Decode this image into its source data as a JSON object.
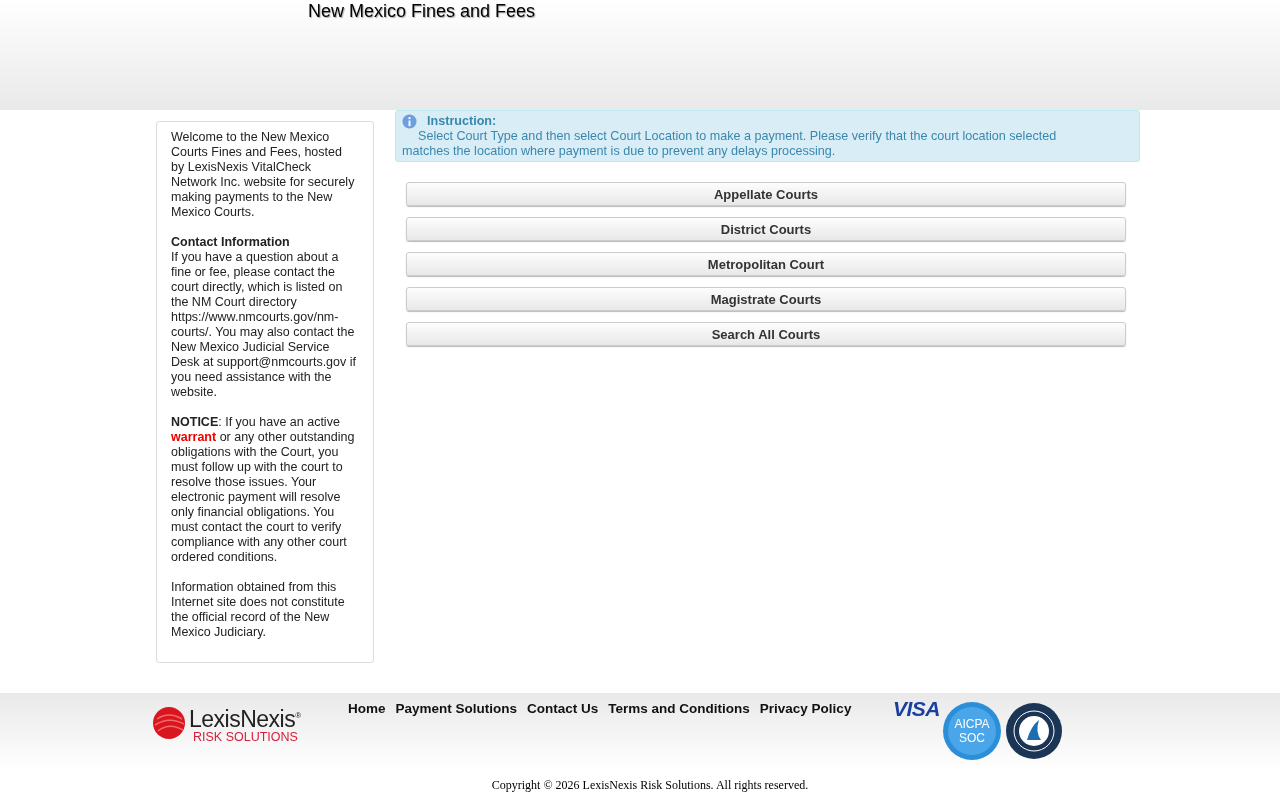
{
  "header": {
    "title": "New Mexico Fines and Fees"
  },
  "sidebar": {
    "intro": "Welcome to the New Mexico Courts Fines and Fees, hosted by LexisNexis VitalCheck Network Inc. website for securely making payments to the New Mexico Courts.",
    "contact_heading": "Contact Information",
    "contact_text": "If you have a question about a fine or fee, please contact the court directly, which is listed on the NM Court directory https://www.nmcourts.gov/nm-courts/. You may also contact the New Mexico Judicial Service Desk at support@nmcourts.gov if you need assistance with the website.",
    "notice_parts": [
      {
        "kind": "bold",
        "text": "NOTICE"
      },
      {
        "kind": "plain",
        "text": ": If you have an active "
      },
      {
        "kind": "alert",
        "text": "warrant"
      },
      {
        "kind": "plain",
        "text": " or any other outstanding obligations with the Court, you must follow up with the court to resolve those issues. Your electronic payment will resolve only financial obligations. You must contact the court to verify compliance with any other court ordered conditions."
      }
    ],
    "disclaimer": "Information obtained from this Internet site does not constitute the official record of the New Mexico Judiciary."
  },
  "instruction": {
    "heading": "Instruction:",
    "text": "Select Court Type and then select Court Location to make a payment. Please verify that the court location selected matches the location where payment is due to prevent any delays processing."
  },
  "court_buttons": [
    "Appellate Courts",
    "District Courts",
    "Metropolitan Court",
    "Magistrate Courts",
    "Search All Courts"
  ],
  "footer": {
    "logo_name": "LexisNexis",
    "logo_mark": "®",
    "logo_sub": "RISK SOLUTIONS",
    "links": [
      "Home",
      "Payment Solutions",
      "Contact Us",
      "Terms and Conditions",
      "Privacy Policy"
    ],
    "visa": "VISA",
    "aicpa": [
      "AICPA",
      "SOC"
    ],
    "copyright": "Copyright © 2026 LexisNexis Risk Solutions. All rights reserved."
  }
}
